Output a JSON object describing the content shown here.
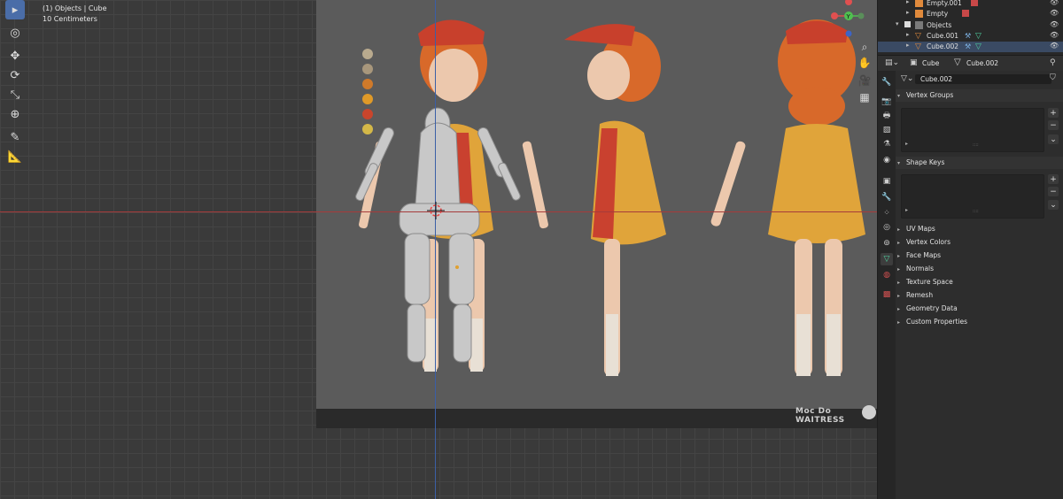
{
  "viewport": {
    "overlay_line1": "(1) Objects | Cube",
    "overlay_line2": "10 Centimeters",
    "reference_title": "Moc Do WAITRESS",
    "gizmo": {
      "y_label": "Y",
      "x_label": "X"
    },
    "swatch_colors": [
      "#b9aa8e",
      "#a8977c",
      "#d07a2a",
      "#e09a28",
      "#c9452c",
      "#d4b848"
    ]
  },
  "toolbar": {
    "tools": [
      "select-tool",
      "cursor-tool",
      "move-tool",
      "rotate-tool",
      "scale-tool",
      "transform-tool",
      "annotate-tool",
      "measure-tool"
    ]
  },
  "outliner": {
    "rows": [
      {
        "name": "Empty.001"
      },
      {
        "name": "Empty"
      },
      {
        "name": "Objects"
      },
      {
        "name": "Cube.001"
      },
      {
        "name": "Cube.002"
      }
    ]
  },
  "properties": {
    "object_name": "Cube",
    "mesh_name": "Cube.002",
    "mesh_field": "Cube.002",
    "sections": {
      "vertex_groups": "Vertex Groups",
      "shape_keys": "Shape Keys",
      "uv_maps": "UV Maps",
      "vertex_colors": "Vertex Colors",
      "face_maps": "Face Maps",
      "normals": "Normals",
      "texture_space": "Texture Space",
      "remesh": "Remesh",
      "geometry_data": "Geometry Data",
      "custom_properties": "Custom Properties"
    },
    "add_label": "+",
    "remove_label": "−",
    "more_label": "⌄"
  }
}
